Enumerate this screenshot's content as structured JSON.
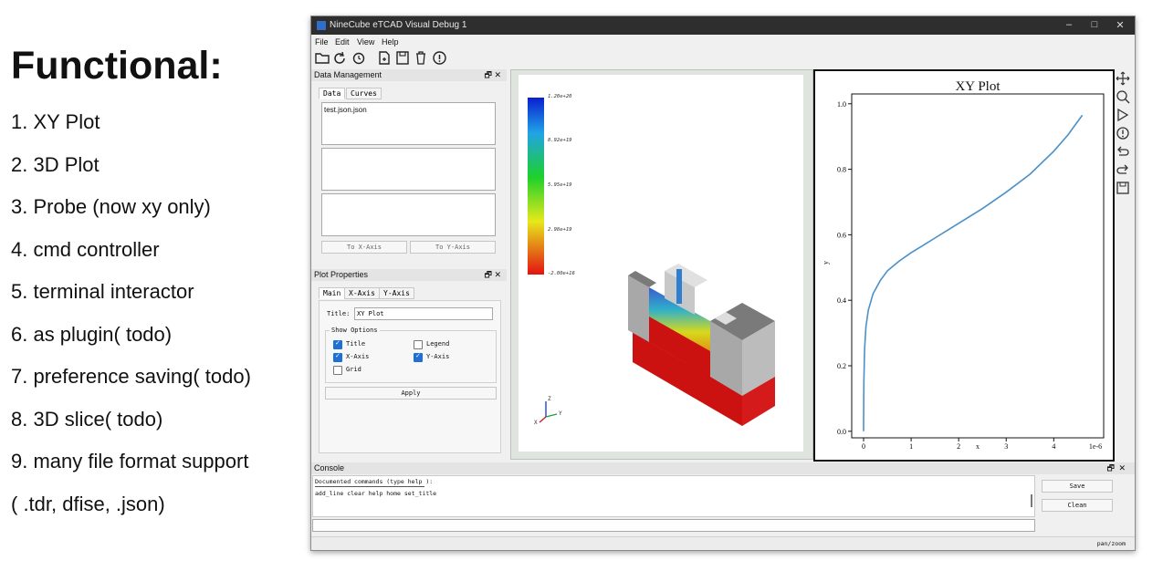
{
  "slide": {
    "heading": "Functional:",
    "items": [
      "1. XY Plot",
      "2. 3D Plot",
      "3. Probe (now xy only)",
      "4. cmd controller",
      "5. terminal interactor",
      "6. as plugin( todo)",
      "7. preference saving( todo)",
      "8. 3D slice( todo)",
      "9. many file format support",
      "( .tdr, dfise, .json)"
    ]
  },
  "window": {
    "title": "NineCube eTCAD Visual Debug 1",
    "controls": {
      "minimize": "–",
      "maximize": "□",
      "close": "✕"
    }
  },
  "menu": {
    "file": "File",
    "edit": "Edit",
    "view": "View",
    "help": "Help"
  },
  "toolbar": {
    "icons": [
      "open-folder-icon",
      "refresh-icon",
      "reload-icon",
      "export-icon",
      "save-icon",
      "delete-icon",
      "info-icon"
    ]
  },
  "data_management": {
    "title": "Data Management",
    "float_btn": "🗗",
    "close_btn": "✕",
    "tabs": [
      "Data",
      "Curves"
    ],
    "files": [
      "test.json.json"
    ],
    "x_axis_btn": "To X-Axis",
    "y_axis_btn": "To Y-Axis"
  },
  "plot_properties": {
    "title": "Plot Properties",
    "float_btn": "🗗",
    "close_btn": "✕",
    "tabs": [
      "Main",
      "X-Axis",
      "Y-Axis"
    ],
    "title_label": "Title:",
    "title_value": "XY Plot",
    "show_options_label": "Show Options",
    "options": [
      {
        "label": "Title",
        "checked": true
      },
      {
        "label": "Legend",
        "checked": false
      },
      {
        "label": "X-Axis",
        "checked": true
      },
      {
        "label": "Y-Axis",
        "checked": true
      },
      {
        "label": "Grid",
        "checked": false
      }
    ],
    "apply": "Apply"
  },
  "view3d": {
    "colorbar_labels": [
      "1.20e+20",
      "8.92e+19",
      "5.95e+19",
      "2.98e+19",
      "-2.00e+16"
    ],
    "colors": {
      "substrate": "#cc1111",
      "oxide": "#a6a6a6",
      "gate": "#d0d0d0",
      "contact": "#777777"
    },
    "axes": {
      "z": "Z",
      "x": "X",
      "y": "Y"
    }
  },
  "xy_plot": {
    "title": "XY Plot",
    "x_scale_note": "1e-6",
    "line_color": "#4a90c8"
  },
  "chart_data": {
    "type": "line",
    "title": "XY Plot",
    "xlabel": "x",
    "ylabel": "y",
    "x_scale": "1e-6",
    "xlim": [
      -0.25,
      5.05
    ],
    "ylim": [
      -0.02,
      1.03
    ],
    "xticks": [
      "0",
      "1",
      "2",
      "3",
      "4"
    ],
    "yticks": [
      "0.0",
      "0.2",
      "0.4",
      "0.6",
      "0.8",
      "1.0"
    ],
    "grid": false,
    "series": [
      {
        "x": [
          0.0,
          0.005,
          0.02,
          0.05,
          0.1,
          0.2,
          0.35,
          0.5,
          0.75,
          1.0,
          1.5,
          2.0,
          2.5,
          3.0,
          3.5,
          4.0,
          4.3,
          4.6
        ],
        "y": [
          0.0,
          0.15,
          0.25,
          0.32,
          0.37,
          0.42,
          0.46,
          0.49,
          0.52,
          0.545,
          0.59,
          0.635,
          0.68,
          0.73,
          0.785,
          0.855,
          0.905,
          0.965
        ]
      }
    ]
  },
  "right_tools": {
    "icons": [
      "pan-icon",
      "zoom-icon",
      "select-arrow-icon",
      "info-icon",
      "undo-icon",
      "redo-icon",
      "save-icon"
    ]
  },
  "console": {
    "title": "Console",
    "float_btn": "🗗",
    "close_btn": "✕",
    "line1": "Documented commands (type help ):",
    "line2": "add_line  clear  help  home  set_title",
    "save": "Save",
    "clean": "Clean"
  },
  "status": {
    "mode": "pan/zoom"
  }
}
